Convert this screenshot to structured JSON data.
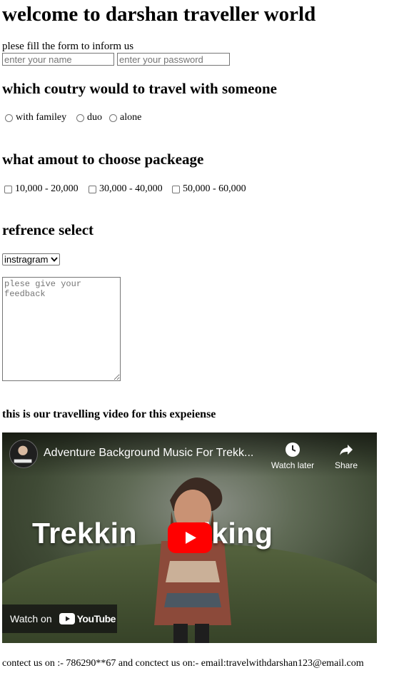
{
  "page": {
    "title": "welcome to darshan traveller world",
    "intro": "plese fill the form to inform us"
  },
  "form": {
    "name_placeholder": "enter your name",
    "password_placeholder": "enter your password",
    "country_heading": "which coutry would to travel with someone",
    "radio_options": [
      "with familey",
      "duo",
      "alone"
    ],
    "package_heading": "what amout to choose packeage",
    "checkbox_options": [
      "10,000 - 20,000",
      "30,000 - 40,000",
      "50,000 - 60,000"
    ],
    "reference_heading": "refrence select",
    "reference_selected": "instragram",
    "feedback_placeholder": "plese give your feedback"
  },
  "video": {
    "heading": "this is our travelling video for this expeiense",
    "title": "Adventure Background Music For Trekk...",
    "watch_later_label": "Watch later",
    "share_label": "Share",
    "thumbnail_text_left": "Trekkin",
    "thumbnail_text_right": "Hiking",
    "watch_on_label": "Watch on",
    "youtube_label": "YouTube"
  },
  "footer": {
    "text": "contect us on :- 786290**67 and conctect us on:- email:travelwithdarshan123@email.com"
  },
  "colors": {
    "youtube_red": "#ff0000",
    "text": "#000000"
  },
  "icons": [
    "radio-icon",
    "checkbox-icon",
    "chevron-down-icon",
    "clock-icon",
    "share-arrow-icon",
    "play-icon",
    "youtube-logo-icon",
    "resize-handle-icon"
  ]
}
